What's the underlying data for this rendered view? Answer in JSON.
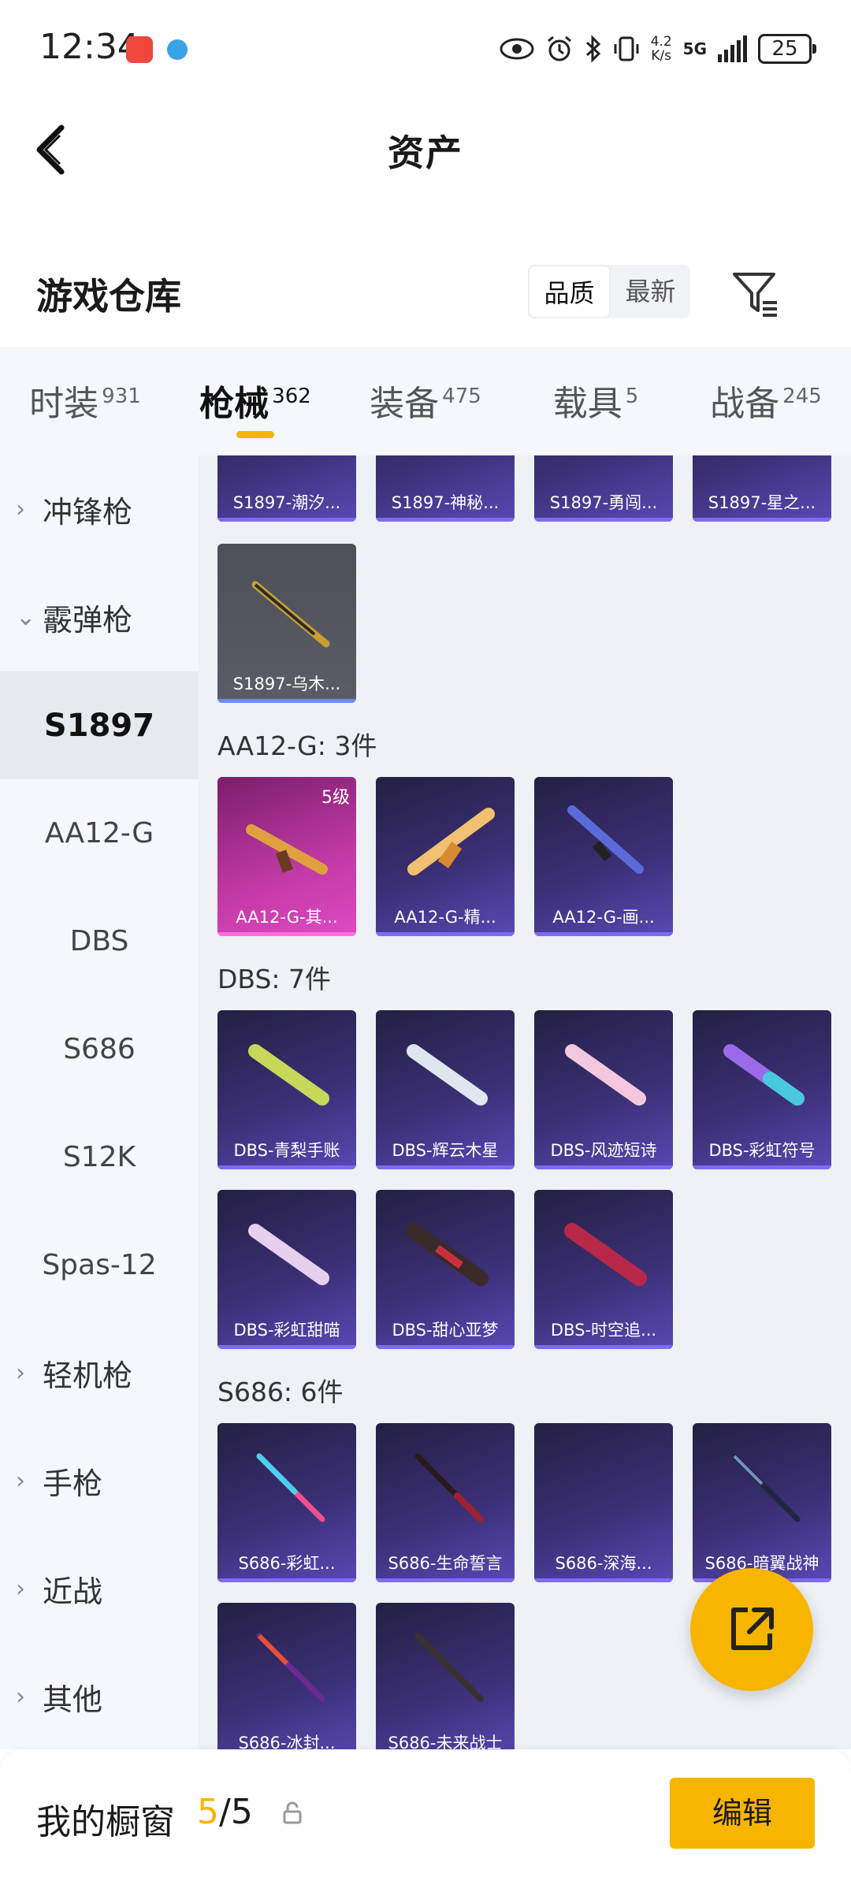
{
  "status_bar": {
    "time": "12:34",
    "speed_value": "4.2",
    "speed_unit": "K/s",
    "network": "5G",
    "battery": "25"
  },
  "nav": {
    "title": "资产"
  },
  "header": {
    "title": "游戏仓库",
    "sort_options": [
      "品质",
      "最新"
    ]
  },
  "tabs": [
    {
      "label": "时装",
      "count": "931"
    },
    {
      "label": "枪械",
      "count": "362"
    },
    {
      "label": "装备",
      "count": "475"
    },
    {
      "label": "载具",
      "count": "5"
    },
    {
      "label": "战备",
      "count": "245"
    }
  ],
  "sidebar": {
    "items": [
      {
        "label": "冲锋枪"
      },
      {
        "label": "霰弹枪"
      },
      {
        "label": "S1897"
      },
      {
        "label": "AA12-G"
      },
      {
        "label": "DBS"
      },
      {
        "label": "S686"
      },
      {
        "label": "S12K"
      },
      {
        "label": "Spas-12"
      },
      {
        "label": "轻机枪"
      },
      {
        "label": "手枪"
      },
      {
        "label": "近战"
      },
      {
        "label": "其他"
      }
    ]
  },
  "sections": {
    "s1897": {
      "items": [
        "S1897-潮汐...",
        "S1897-神秘...",
        "S1897-勇闯...",
        "S1897-星之...",
        "S1897-乌木..."
      ]
    },
    "aa12": {
      "title": "AA12-G: 3件",
      "items": [
        "AA12-G-其...",
        "AA12-G-精...",
        "AA12-G-画..."
      ],
      "level_badge": "5级"
    },
    "dbs": {
      "title": "DBS: 7件",
      "items": [
        "DBS-青梨手账",
        "DBS-辉云木星",
        "DBS-风迹短诗",
        "DBS-彩虹符号",
        "DBS-彩虹甜喵",
        "DBS-甜心亚梦",
        "DBS-时空追..."
      ]
    },
    "s686": {
      "title": "S686: 6件",
      "items": [
        "S686-彩虹...",
        "S686-生命誓言",
        "S686-深海...",
        "S686-暗翼战神",
        "S686-冰封...",
        "S686-未来战士"
      ]
    }
  },
  "bottom": {
    "title": "我的橱窗",
    "current": "5",
    "separator": "/",
    "max": "5",
    "edit_label": "编辑"
  },
  "colors": {
    "accent": "#f7b500",
    "card_purple": "#3a2f74",
    "card_pink": "#c23aa6",
    "card_gray": "#55575f"
  },
  "icons": [
    "back-arrow-icon",
    "filter-icon",
    "chevron-right-icon",
    "chevron-down-icon",
    "share-external-icon",
    "lock-icon"
  ]
}
